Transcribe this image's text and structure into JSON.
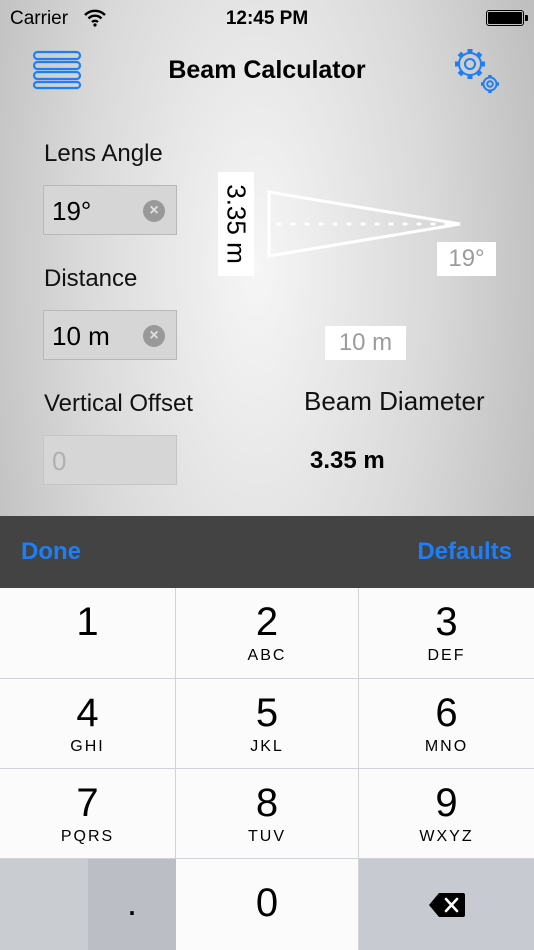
{
  "status_bar": {
    "carrier": "Carrier",
    "time": "12:45 PM"
  },
  "nav": {
    "title": "Beam Calculator"
  },
  "lens_angle": {
    "label": "Lens Angle",
    "value": "19°"
  },
  "distance": {
    "label": "Distance",
    "value": "10 m"
  },
  "vertical_offset": {
    "label": "Vertical Offset",
    "placeholder": "0"
  },
  "diagram": {
    "diameter_label": "3.35 m",
    "angle_label": "19°",
    "distance_label": "10 m"
  },
  "beam_diameter": {
    "label": "Beam Diameter",
    "value": "3.35 m"
  },
  "accessory_bar": {
    "done": "Done",
    "defaults": "Defaults"
  },
  "keypad": {
    "keys": [
      {
        "digit": "1",
        "letters": ""
      },
      {
        "digit": "2",
        "letters": "ABC"
      },
      {
        "digit": "3",
        "letters": "DEF"
      },
      {
        "digit": "4",
        "letters": "GHI"
      },
      {
        "digit": "5",
        "letters": "JKL"
      },
      {
        "digit": "6",
        "letters": "MNO"
      },
      {
        "digit": "7",
        "letters": "PQRS"
      },
      {
        "digit": "8",
        "letters": "TUV"
      },
      {
        "digit": "9",
        "letters": "WXYZ"
      },
      {
        "digit": "0",
        "letters": ""
      }
    ],
    "decimal": "."
  },
  "colors": {
    "accent": "#1E7EF5",
    "accessory_bar": "#434343"
  },
  "icons": [
    "menu-icon",
    "settings-gears-icon",
    "clear-icon",
    "backspace-icon",
    "wifi-icon",
    "battery-icon"
  ]
}
